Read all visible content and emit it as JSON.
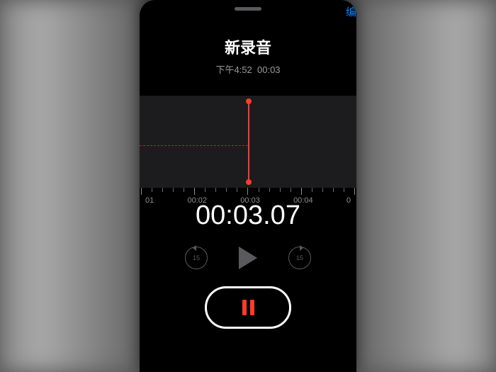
{
  "header": {
    "edit_label": "编辑",
    "title": "新录音",
    "time_of_day": "下午4:52",
    "duration": "00:03"
  },
  "timeline": {
    "ticks": [
      "01",
      "00:02",
      "00:03",
      "00:04",
      "0"
    ]
  },
  "elapsed": "00:03.07",
  "controls": {
    "skip_back_seconds": "15",
    "skip_forward_seconds": "15"
  },
  "colors": {
    "accent": "#ff3b30",
    "link": "#0a84ff"
  }
}
